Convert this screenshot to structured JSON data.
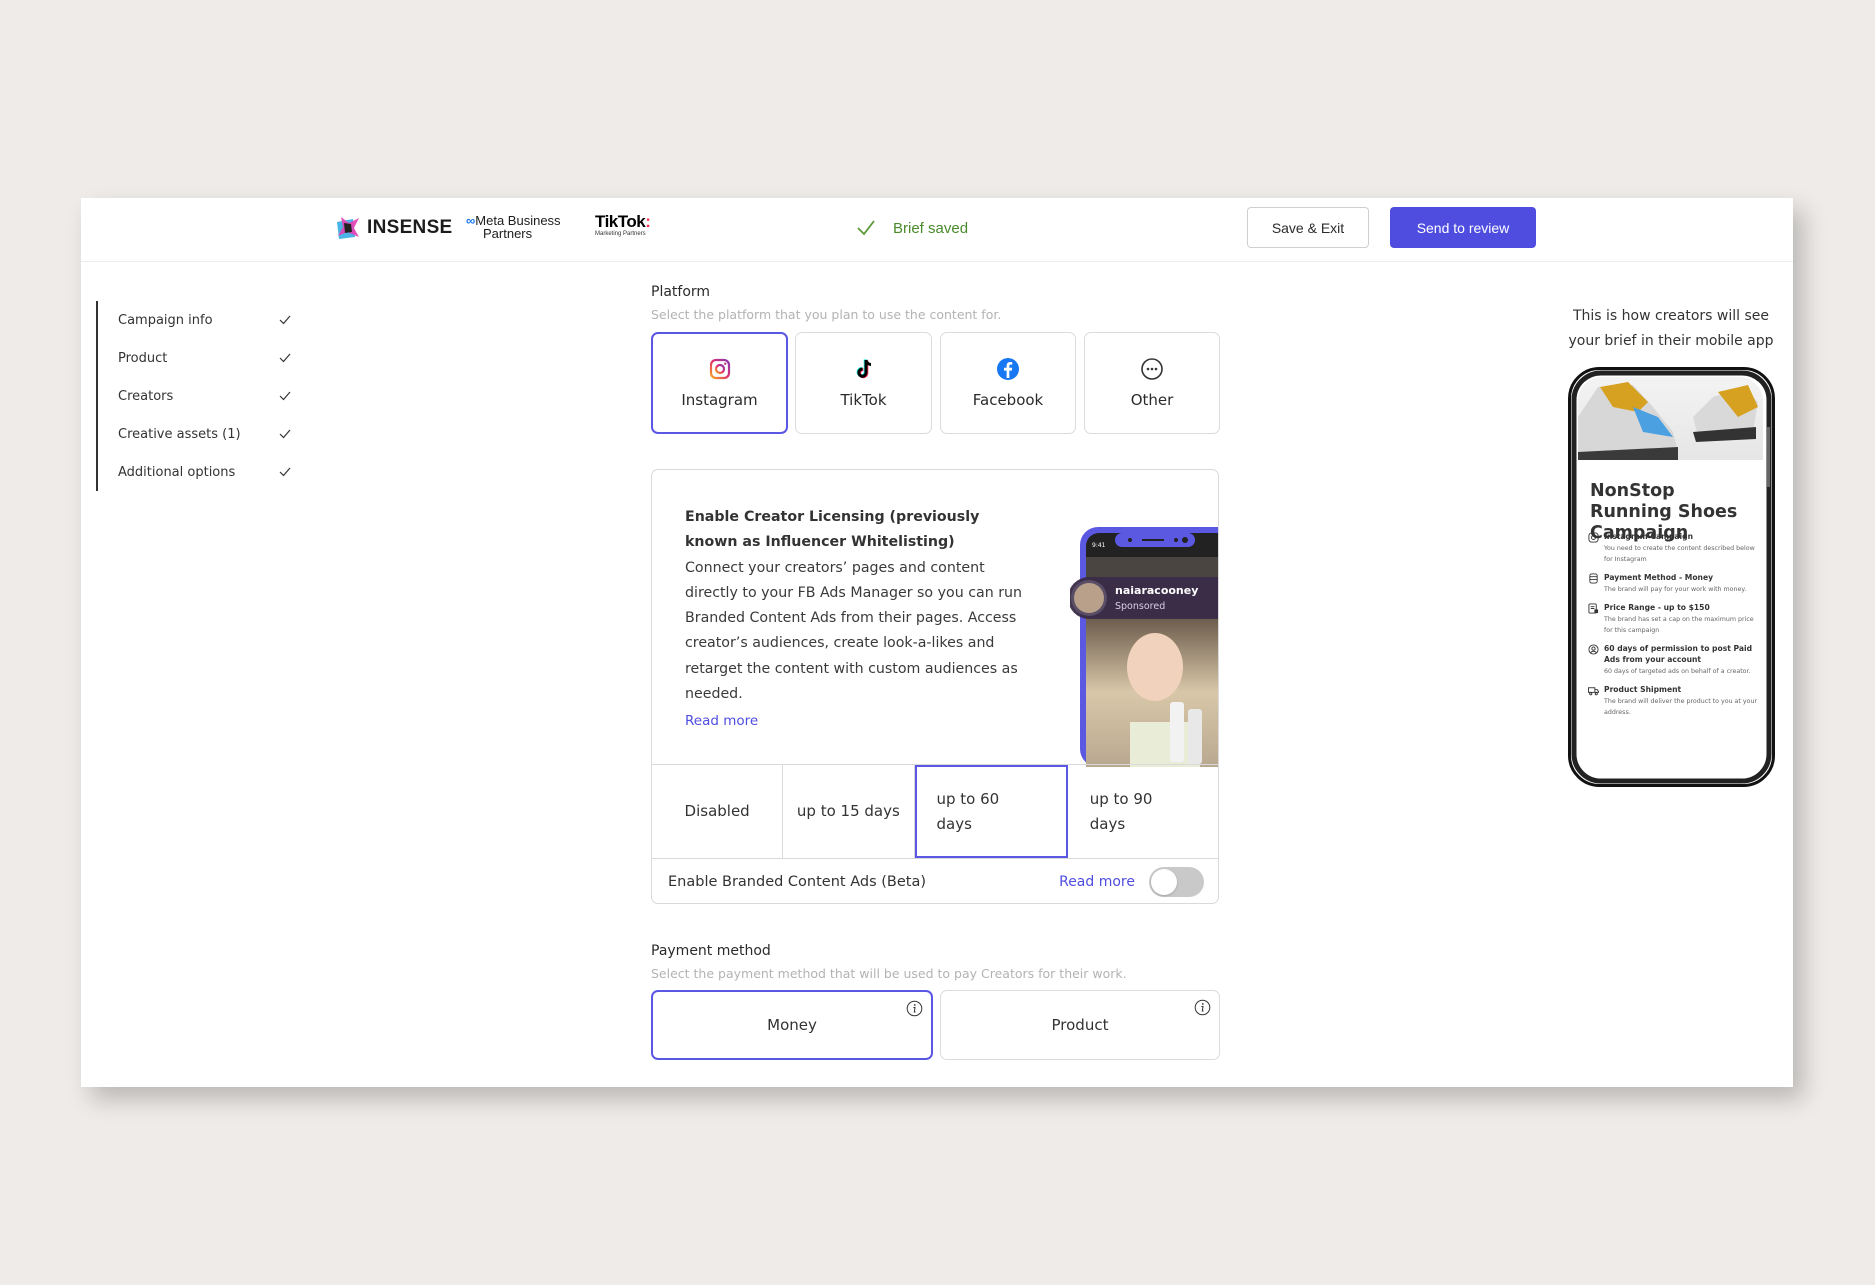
{
  "header": {
    "logos": {
      "insense": "INSENSE",
      "meta_line1": "Meta Business",
      "meta_line2": "Partners",
      "tiktok": "TikTok",
      "tiktok_sub": "Marketing Partners"
    },
    "status": "Brief saved",
    "save_exit_label": "Save & Exit",
    "send_review_label": "Send to review"
  },
  "sidebar": {
    "items": [
      {
        "label": "Campaign info",
        "done": true
      },
      {
        "label": "Product",
        "done": true
      },
      {
        "label": "Creators",
        "done": true
      },
      {
        "label": "Creative assets (1)",
        "done": true
      },
      {
        "label": "Additional options",
        "done": true
      }
    ]
  },
  "platform": {
    "title": "Platform",
    "subtitle": "Select the platform that you plan to use the content for.",
    "options": [
      {
        "label": "Instagram",
        "icon": "instagram-icon",
        "selected": true
      },
      {
        "label": "TikTok",
        "icon": "tiktok-icon",
        "selected": false
      },
      {
        "label": "Facebook",
        "icon": "facebook-icon",
        "selected": false
      },
      {
        "label": "Other",
        "icon": "more-dots-icon",
        "selected": false
      }
    ]
  },
  "licensing": {
    "title": "Enable Creator Licensing (previously known as Influencer Whitelisting)",
    "description": "Connect your creators’ pages and content directly to your FB Ads Manager so you can run Branded Content Ads from their pages. Access creator’s audiences, create look-a-likes and retarget the content with custom audiences as needed.",
    "read_more": "Read more",
    "preview": {
      "username": "naiaracooney",
      "sponsored": "Sponsored",
      "time": "9:41"
    },
    "durations": [
      {
        "label": "Disabled",
        "selected": false
      },
      {
        "label": "up to 15 days",
        "selected": false
      },
      {
        "label": "up to 60 days",
        "selected": true
      },
      {
        "label": "up to 90 days",
        "selected": false
      }
    ],
    "branded_ads": {
      "label": "Enable Branded Content Ads (Beta)",
      "read_more": "Read more",
      "enabled": false
    }
  },
  "payment": {
    "title": "Payment method",
    "subtitle": "Select the payment method that will be used to pay Creators for their work.",
    "options": [
      {
        "label": "Money",
        "selected": true
      },
      {
        "label": "Product",
        "selected": false
      }
    ]
  },
  "preview": {
    "caption": "This is how creators will see your brief in their mobile app",
    "campaign_title": "NonStop Running Shoes Campaign",
    "items": [
      {
        "icon": "instagram-icon",
        "title": "Instagram Campaign",
        "desc": "You need to create the content described below for Instagram"
      },
      {
        "icon": "money-icon",
        "title": "Payment Method - Money",
        "desc": "The brand will pay for your work with money."
      },
      {
        "icon": "price-tag-icon",
        "title": "Price Range - up to $150",
        "desc": "The brand has set a cap on the maximum price for this campaign"
      },
      {
        "icon": "user-circle-icon",
        "title": "60 days of permission to post Paid Ads from your account",
        "desc": "60 days of targeted ads on behalf of a creator."
      },
      {
        "icon": "truck-icon",
        "title": "Product Shipment",
        "desc": "The brand will deliver the product to you at your address."
      }
    ]
  },
  "colors": {
    "accent": "#4f4de0",
    "success": "#4a8a2a",
    "background": "#eeebe8"
  }
}
